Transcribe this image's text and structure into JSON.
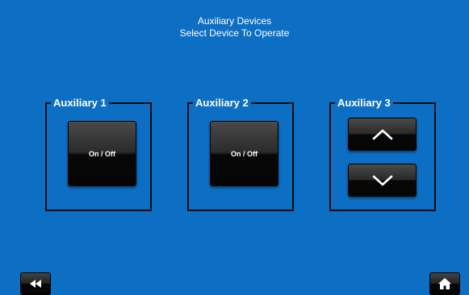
{
  "header": {
    "title": "Auxiliary Devices",
    "subtitle": "Select Device To Operate"
  },
  "groups": [
    {
      "label": "Auxiliary 1",
      "button_label": "On / Off"
    },
    {
      "label": "Auxiliary 2",
      "button_label": "On / Off"
    },
    {
      "label": "Auxiliary 3",
      "up_icon": "chevron-up-icon",
      "down_icon": "chevron-down-icon"
    }
  ],
  "nav": {
    "back_icon": "rewind-icon",
    "home_icon": "home-icon"
  },
  "colors": {
    "background": "#0d6fc4",
    "button": "#1a1a1a",
    "text": "#ffffff",
    "border": "#0a0a0a"
  }
}
